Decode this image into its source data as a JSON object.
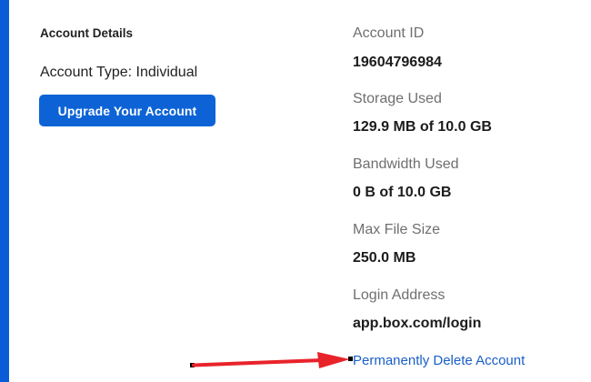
{
  "colors": {
    "accent_bar": "#0a5bd8",
    "button": "#0d63d6",
    "link": "#1a5fc7",
    "annotation_arrow": "#e8232a"
  },
  "account": {
    "section_title": "Account Details",
    "account_type": "Account Type: Individual",
    "upgrade_button": "Upgrade Your Account"
  },
  "details": {
    "account_id_label": "Account ID",
    "account_id_value": "19604796984",
    "storage_label": "Storage Used",
    "storage_value": "129.9 MB of 10.0 GB",
    "bandwidth_label": "Bandwidth Used",
    "bandwidth_value": "0 B of 10.0 GB",
    "max_file_label": "Max File Size",
    "max_file_value": "250.0 MB",
    "login_label": "Login Address",
    "login_value": "app.box.com/login"
  },
  "delete_link": "Permanently Delete Account",
  "annotation": {
    "icon": "red-arrow-icon"
  }
}
